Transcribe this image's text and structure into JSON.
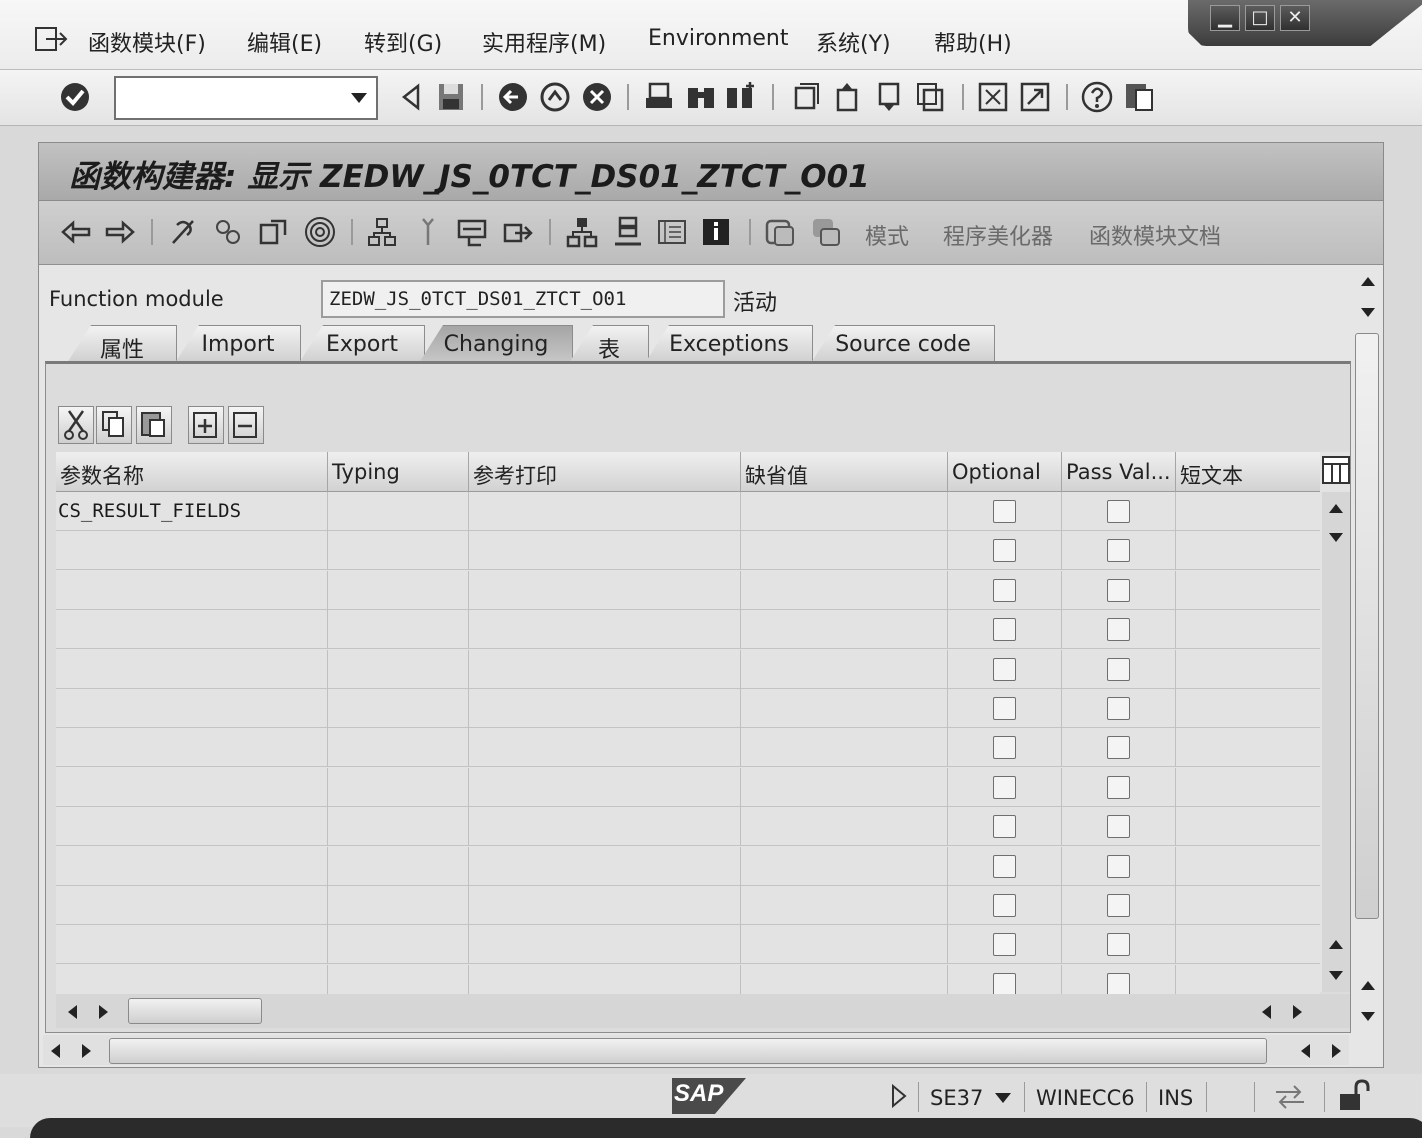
{
  "menubar": {
    "items": [
      "函数模块(F)",
      "编辑(E)",
      "转到(G)",
      "实用程序(M)",
      "Environment",
      "系统(Y)",
      "帮助(H)"
    ]
  },
  "window_controls": {
    "minimize": "▁",
    "maximize": "□",
    "close": "✕"
  },
  "command_field": {
    "value": ""
  },
  "title": "函数构建器: 显示 ZEDW_JS_0TCT_DS01_ZTCT_O01",
  "app_toolbar": {
    "text_buttons": [
      "模式",
      "程序美化器",
      "函数模块文档"
    ]
  },
  "function_module": {
    "label": "Function module",
    "value": "ZEDW_JS_0TCT_DS01_ZTCT_O01",
    "status": "活动"
  },
  "tabs": [
    {
      "label": "属性",
      "active": false
    },
    {
      "label": "Import",
      "active": false
    },
    {
      "label": "Export",
      "active": false
    },
    {
      "label": "Changing",
      "active": true
    },
    {
      "label": "表",
      "active": false
    },
    {
      "label": "Exceptions",
      "active": false
    },
    {
      "label": "Source code",
      "active": false
    }
  ],
  "table": {
    "columns": [
      "参数名称",
      "Typing",
      "参考打印",
      "缺省值",
      "Optional",
      "Pass Val...",
      "短文本"
    ],
    "rows": [
      {
        "name": "CS_RESULT_FIELDS",
        "typing": "",
        "reference": "",
        "default": "",
        "optional": false,
        "pass_value": false,
        "short_text": ""
      },
      {
        "name": "",
        "typing": "",
        "reference": "",
        "default": "",
        "optional": false,
        "pass_value": false,
        "short_text": ""
      },
      {
        "name": "",
        "typing": "",
        "reference": "",
        "default": "",
        "optional": false,
        "pass_value": false,
        "short_text": ""
      },
      {
        "name": "",
        "typing": "",
        "reference": "",
        "default": "",
        "optional": false,
        "pass_value": false,
        "short_text": ""
      },
      {
        "name": "",
        "typing": "",
        "reference": "",
        "default": "",
        "optional": false,
        "pass_value": false,
        "short_text": ""
      },
      {
        "name": "",
        "typing": "",
        "reference": "",
        "default": "",
        "optional": false,
        "pass_value": false,
        "short_text": ""
      },
      {
        "name": "",
        "typing": "",
        "reference": "",
        "default": "",
        "optional": false,
        "pass_value": false,
        "short_text": ""
      },
      {
        "name": "",
        "typing": "",
        "reference": "",
        "default": "",
        "optional": false,
        "pass_value": false,
        "short_text": ""
      },
      {
        "name": "",
        "typing": "",
        "reference": "",
        "default": "",
        "optional": false,
        "pass_value": false,
        "short_text": ""
      },
      {
        "name": "",
        "typing": "",
        "reference": "",
        "default": "",
        "optional": false,
        "pass_value": false,
        "short_text": ""
      },
      {
        "name": "",
        "typing": "",
        "reference": "",
        "default": "",
        "optional": false,
        "pass_value": false,
        "short_text": ""
      },
      {
        "name": "",
        "typing": "",
        "reference": "",
        "default": "",
        "optional": false,
        "pass_value": false,
        "short_text": ""
      },
      {
        "name": "",
        "typing": "",
        "reference": "",
        "default": "",
        "optional": false,
        "pass_value": false,
        "short_text": ""
      }
    ]
  },
  "statusbar": {
    "logo": "SAP",
    "transaction": "SE37",
    "system": "WINECC6",
    "mode": "INS"
  },
  "colors": {
    "background": "#d9d9d9",
    "title_bar": "#b4b4b4",
    "active_tab": "#a5a5a5"
  }
}
